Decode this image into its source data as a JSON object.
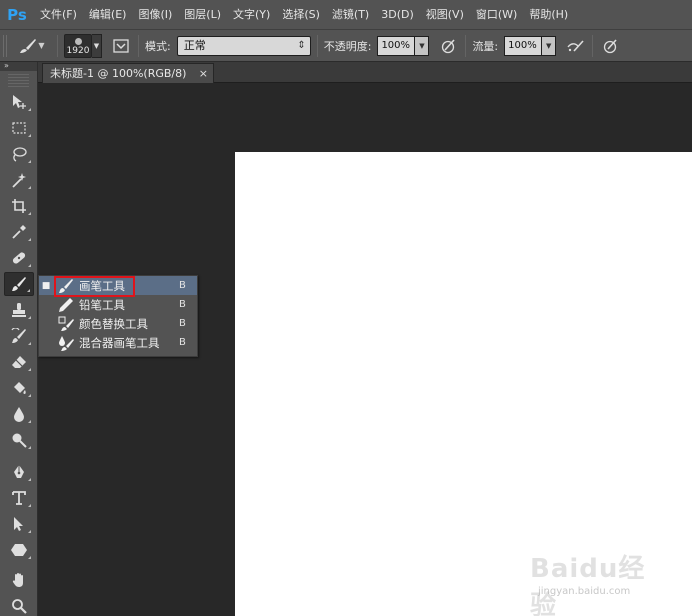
{
  "app": {
    "logo": "Ps"
  },
  "menu": [
    "文件(F)",
    "编辑(E)",
    "图像(I)",
    "图层(L)",
    "文字(Y)",
    "选择(S)",
    "滤镜(T)",
    "3D(D)",
    "视图(V)",
    "窗口(W)",
    "帮助(H)"
  ],
  "options": {
    "brush_size": "1920",
    "mode_label": "模式:",
    "mode_value": "正常",
    "opacity_label": "不透明度:",
    "opacity_value": "100%",
    "flow_label": "流量:",
    "flow_value": "100%"
  },
  "document": {
    "tab_title": "未标题-1 @ 100%(RGB/8)",
    "close": "×"
  },
  "toolbar": {
    "collapse": "»"
  },
  "flyout": [
    {
      "label": "画笔工具",
      "key": "B",
      "icon": "brush-icon",
      "selected": true
    },
    {
      "label": "铅笔工具",
      "key": "B",
      "icon": "pencil-icon",
      "selected": false
    },
    {
      "label": "颜色替换工具",
      "key": "B",
      "icon": "color-replace-icon",
      "selected": false
    },
    {
      "label": "混合器画笔工具",
      "key": "B",
      "icon": "mixer-brush-icon",
      "selected": false
    }
  ],
  "watermark": {
    "text": "Baidu经验",
    "url": "jingyan.baidu.com"
  },
  "colors": {
    "highlight": "#e0141b",
    "selection": "#5b6e87",
    "ps_blue": "#2fa3f5"
  }
}
